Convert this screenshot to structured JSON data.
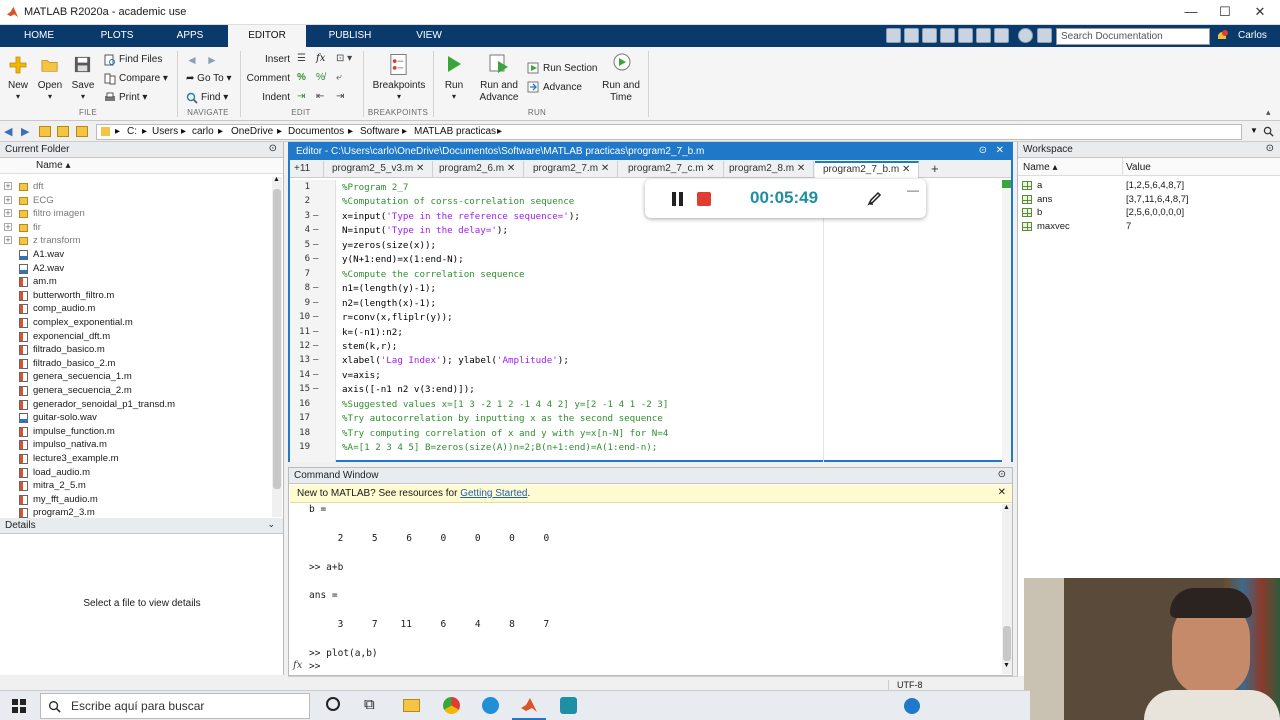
{
  "window": {
    "title": "MATLAB R2020a - academic use"
  },
  "ribbon_tabs": [
    "HOME",
    "PLOTS",
    "APPS",
    "EDITOR",
    "PUBLISH",
    "VIEW"
  ],
  "search": {
    "placeholder": "Search Documentation"
  },
  "user": "Carlos",
  "ribbon": {
    "file": {
      "new": "New",
      "open": "Open",
      "save": "Save",
      "find_files": "Find Files",
      "compare": "Compare",
      "print": "Print",
      "group": "FILE"
    },
    "navigate": {
      "go_to": "Go To",
      "find": "Find",
      "group": "NAVIGATE"
    },
    "edit": {
      "insert": "Insert",
      "comment": "Comment",
      "indent": "Indent",
      "group": "EDIT"
    },
    "breakpoints": {
      "label": "Breakpoints",
      "group": "BREAKPOINTS"
    },
    "run": {
      "run": "Run",
      "run_advance": "Run and Advance",
      "run_section": "Run Section",
      "advance": "Advance",
      "run_time": "Run and Time",
      "group": "RUN"
    }
  },
  "address": [
    "C:",
    "Users",
    "carlo",
    "OneDrive",
    "Documentos",
    "Software",
    "MATLAB practicas"
  ],
  "current_folder": {
    "title": "Current Folder",
    "col_name": "Name",
    "items": [
      {
        "name": "dft",
        "type": "folder"
      },
      {
        "name": "ECG",
        "type": "folder"
      },
      {
        "name": "filtro imagen",
        "type": "folder"
      },
      {
        "name": "fir",
        "type": "folder"
      },
      {
        "name": "z transform",
        "type": "folder"
      },
      {
        "name": "A1.wav",
        "type": "wav"
      },
      {
        "name": "A2.wav",
        "type": "wav"
      },
      {
        "name": "am.m",
        "type": "m"
      },
      {
        "name": "butterworth_filtro.m",
        "type": "m"
      },
      {
        "name": "comp_audio.m",
        "type": "m"
      },
      {
        "name": "complex_exponential.m",
        "type": "m"
      },
      {
        "name": "exponencial_dft.m",
        "type": "m"
      },
      {
        "name": "filtrado_basico.m",
        "type": "m"
      },
      {
        "name": "filtrado_basico_2.m",
        "type": "m"
      },
      {
        "name": "genera_secuencia_1.m",
        "type": "m"
      },
      {
        "name": "genera_secuencia_2.m",
        "type": "m"
      },
      {
        "name": "generador_senoidal_p1_transd.m",
        "type": "m"
      },
      {
        "name": "guitar-solo.wav",
        "type": "wav"
      },
      {
        "name": "impulse_function.m",
        "type": "m"
      },
      {
        "name": "impulso_nativa.m",
        "type": "m"
      },
      {
        "name": "lecture3_example.m",
        "type": "m"
      },
      {
        "name": "load_audio.m",
        "type": "m"
      },
      {
        "name": "mitra_2_5.m",
        "type": "m"
      },
      {
        "name": "my_fft_audio.m",
        "type": "m"
      },
      {
        "name": "program2_3.m",
        "type": "m"
      }
    ]
  },
  "details": {
    "title": "Details",
    "message": "Select a file to view details"
  },
  "editor": {
    "title": "Editor - C:\\Users\\carlo\\OneDrive\\Documentos\\Software\\MATLAB practicas\\program2_7_b.m",
    "pin": "+11",
    "tabs": [
      "program2_5_v3.m",
      "program2_6.m",
      "program2_7.m",
      "program2_7_c.m",
      "program2_8.m",
      "program2_7_b.m"
    ],
    "lines": [
      {
        "n": "1",
        "dash": "",
        "cls": "cmt",
        "text": "%Program 2_7"
      },
      {
        "n": "2",
        "dash": "",
        "cls": "cmt",
        "text": "%Computation of corss-correlation sequence"
      },
      {
        "n": "3",
        "dash": "—",
        "cls": "",
        "pre": "x=input(",
        "str": "'Type in the reference sequence='",
        "post": ");"
      },
      {
        "n": "4",
        "dash": "—",
        "cls": "",
        "pre": "N=input(",
        "str": "'Type in the delay='",
        "post": ");"
      },
      {
        "n": "5",
        "dash": "—",
        "cls": "",
        "text": "y=zeros(size(x));"
      },
      {
        "n": "6",
        "dash": "—",
        "cls": "",
        "text": "y(N+1:end)=x(1:end-N);"
      },
      {
        "n": "7",
        "dash": "",
        "cls": "cmt",
        "text": "%Compute the correlation sequence"
      },
      {
        "n": "8",
        "dash": "—",
        "cls": "",
        "text": "n1=(length(y)-1);"
      },
      {
        "n": "9",
        "dash": "—",
        "cls": "",
        "text": "n2=(length(x)-1);"
      },
      {
        "n": "10",
        "dash": "—",
        "cls": "",
        "text": "r=conv(x,fliplr(y));"
      },
      {
        "n": "11",
        "dash": "—",
        "cls": "",
        "text": "k=(-n1):n2;"
      },
      {
        "n": "12",
        "dash": "—",
        "cls": "",
        "text": "stem(k,r);"
      },
      {
        "n": "13",
        "dash": "—",
        "cls": "",
        "pre": "xlabel(",
        "str": "'Lag Index'",
        "post": "); ylabel(",
        "str2": "'Amplitude'",
        "post2": ");"
      },
      {
        "n": "14",
        "dash": "—",
        "cls": "",
        "text": "v=axis;"
      },
      {
        "n": "15",
        "dash": "—",
        "cls": "",
        "text": "axis([-n1 n2 v(3:end)]);"
      },
      {
        "n": "16",
        "dash": "",
        "cls": "cmt",
        "text": "%Suggested values x=[1 3 -2 1 2 -1 4 4 2] y=[2 -1 4 1 -2 3]"
      },
      {
        "n": "17",
        "dash": "",
        "cls": "cmt",
        "text": "%Try autocorrelation by inputting x as the second sequence"
      },
      {
        "n": "18",
        "dash": "",
        "cls": "cmt",
        "text": "%Try computing correlation of x and y with y=x[n-N] for N=4"
      },
      {
        "n": "19",
        "dash": "",
        "cls": "cmt",
        "text": "%A=[1 2 3 4 5] B=zeros(size(A))n=2;B(n+1:end)=A(1:end-n);"
      }
    ]
  },
  "recorder": {
    "time": "00:05:49"
  },
  "command_window": {
    "title": "Command Window",
    "notice_text": "New to MATLAB? See resources for ",
    "notice_link": "Getting Started",
    "notice_end": ".",
    "lines": [
      "b =",
      "",
      "     2     5     6     0     0     0     0",
      "",
      ">> a+b",
      "",
      "ans =",
      "",
      "     3     7    11     6     4     8     7",
      "",
      ">> plot(a,b)"
    ],
    "prompt": ">>",
    "fx": "fx"
  },
  "workspace": {
    "title": "Workspace",
    "col_name": "Name",
    "col_value": "Value",
    "vars": [
      {
        "name": "a",
        "value": "[1,2,5,6,4,8,7]"
      },
      {
        "name": "ans",
        "value": "[3,7,11,6,4,8,7]"
      },
      {
        "name": "b",
        "value": "[2,5,6,0,0,0,0]"
      },
      {
        "name": "maxvec",
        "value": "7"
      }
    ]
  },
  "status": {
    "encoding": "UTF-8"
  },
  "taskbar": {
    "search_placeholder": "Escribe aquí para buscar"
  },
  "colors": {
    "accent": "#1f78c8",
    "ribbon_tab_bg": "#0a3a6b",
    "comment": "#2f8f2f",
    "string": "#a020f0",
    "record": "#e03c31",
    "timer": "#1f8fa6"
  }
}
